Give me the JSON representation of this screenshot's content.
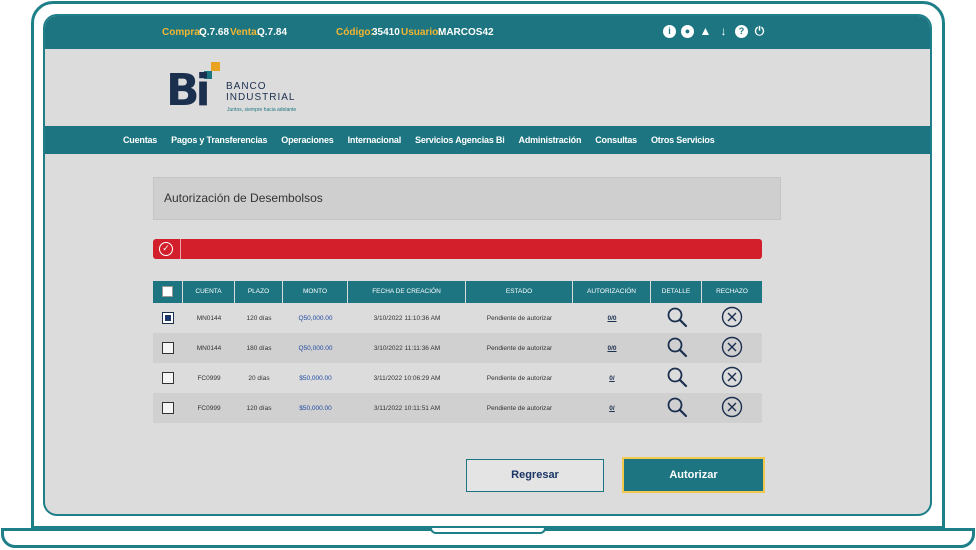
{
  "topbar": {
    "compra_label": "Compra:",
    "compra_value": "Q.7.68",
    "venta_label": "Venta:",
    "venta_value": "Q.7.84",
    "codigo_label": "Código:",
    "codigo_value": "35410",
    "usuario_label": "Usuario:",
    "usuario_value": "MARCOS42",
    "icons": [
      "info-icon",
      "user-icon",
      "bulb-icon",
      "download-icon",
      "help-icon",
      "power-icon"
    ]
  },
  "logo": {
    "mark": "Bi",
    "name_line1": "BANCO",
    "name_line2": "INDUSTRIAL",
    "slogan": "Juntos, siempre hacia adelante"
  },
  "nav": {
    "items": [
      "Cuentas",
      "Pagos y Transferencias",
      "Operaciones",
      "Internacional",
      "Servicios Agencias Bi",
      "Administración",
      "Consultas",
      "Otros Servicios"
    ]
  },
  "page": {
    "title": "Autorización de Desembolsos"
  },
  "alert": {
    "icon": "check-circle-icon",
    "color": "#d21f2b"
  },
  "table": {
    "headers": [
      "",
      "CUENTA",
      "PLAZO",
      "MONTO",
      "FECHA DE CREACIÓN",
      "ESTADO",
      "AUTORIZACIÓN",
      "DETALLE",
      "RECHAZO"
    ],
    "rows": [
      {
        "checked": true,
        "cuenta": "MN0144",
        "plazo": "120 días",
        "monto": "Q50,000.00",
        "fecha": "3/10/2022 11:10:36 AM",
        "estado": "Pendiente de autorizar",
        "autorizacion": "0/0"
      },
      {
        "checked": false,
        "cuenta": "MN0144",
        "plazo": "180 días",
        "monto": "Q50,000.00",
        "fecha": "3/10/2022 11:11:36 AM",
        "estado": "Pendiente de autorizar",
        "autorizacion": "0/0"
      },
      {
        "checked": false,
        "cuenta": "FC0999",
        "plazo": "20 días",
        "monto": "$50,000.00",
        "fecha": "3/11/2022 10:06:29 AM",
        "estado": "Pendiente de autorizar",
        "autorizacion": "0/"
      },
      {
        "checked": false,
        "cuenta": "FC0999",
        "plazo": "120 días",
        "monto": "$50,000.00",
        "fecha": "3/11/2022 10:11:51 AM",
        "estado": "Pendiente de autorizar",
        "autorizacion": "0/"
      }
    ]
  },
  "buttons": {
    "back": "Regresar",
    "authorize": "Autorizar"
  },
  "colors": {
    "brand_teal": "#1c7580",
    "brand_navy": "#1b2f4f",
    "accent_gold": "#f2c94c",
    "alert_red": "#d21f2b"
  }
}
